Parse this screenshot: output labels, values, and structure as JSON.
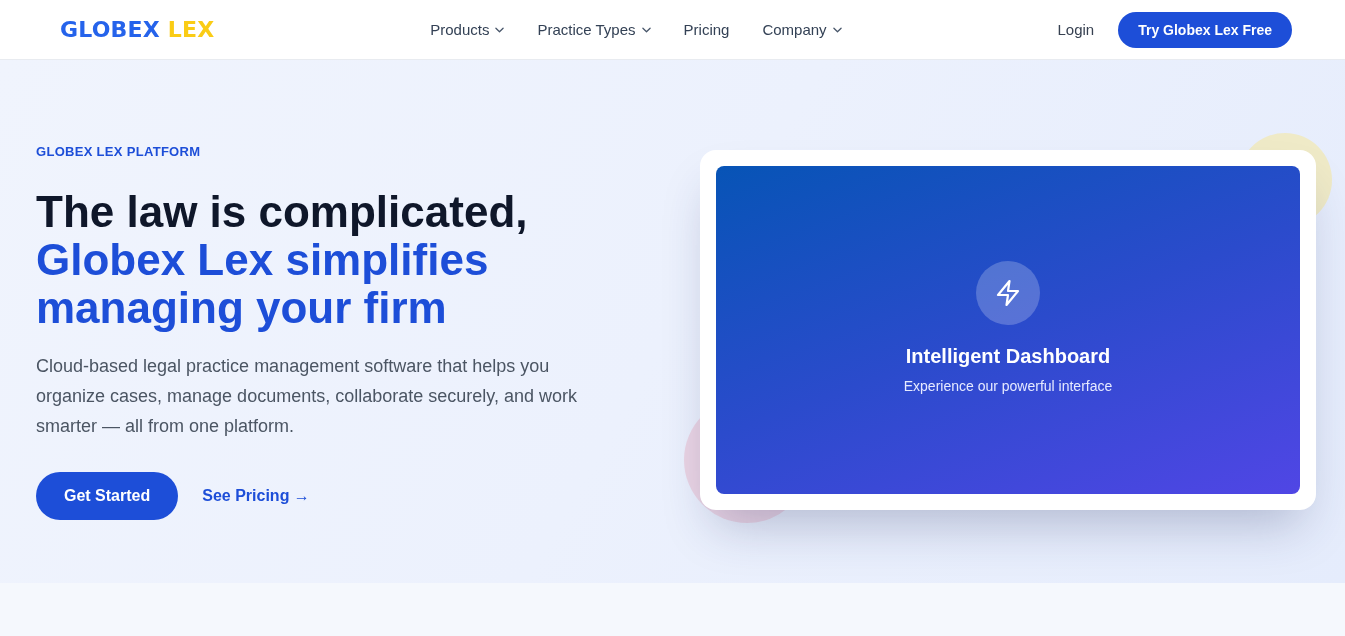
{
  "header": {
    "logo": {
      "primary": "GLOBEX",
      "accent": "LEX"
    },
    "nav": [
      {
        "label": "Products",
        "has_menu": true
      },
      {
        "label": "Practice Types",
        "has_menu": true
      },
      {
        "label": "Pricing",
        "has_menu": false
      },
      {
        "label": "Company",
        "has_menu": true
      }
    ],
    "login": "Login",
    "cta": "Try Globex Lex Free"
  },
  "hero": {
    "eyebrow": "GLOBEX LEX PLATFORM",
    "heading": "The law is complicated,",
    "heading_highlight": "Globex Lex simplifies managing your firm",
    "description": "Cloud-based legal practice management software that helps you organize cases, manage documents, collaborate securely, and work smarter — all from one platform.",
    "primary_button": "Get Started",
    "secondary_link": "See Pricing →"
  },
  "preview": {
    "title": "Intelligent Dashboard",
    "subtitle": "Experience our powerful interface"
  }
}
